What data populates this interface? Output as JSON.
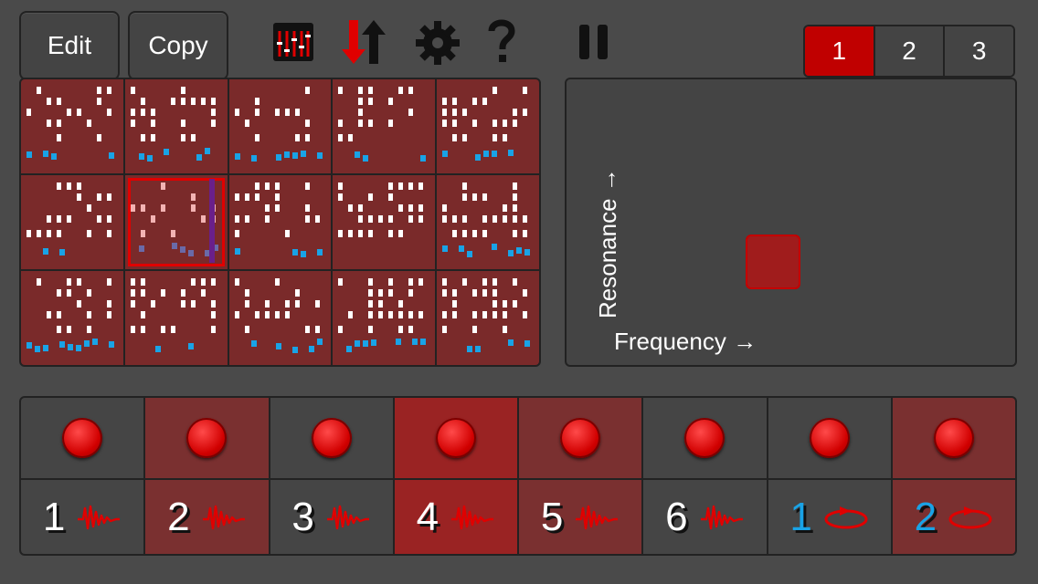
{
  "toolbar": {
    "edit_label": "Edit",
    "copy_label": "Copy",
    "icons": [
      "mixer-icon",
      "sort-arrows-icon",
      "gear-icon",
      "help-icon",
      "pause-icon"
    ]
  },
  "pages": {
    "tabs": [
      "1",
      "2",
      "3"
    ],
    "selected": "1"
  },
  "xy_pad": {
    "y_label": "Resonance →",
    "x_label": "Frequency →"
  },
  "tracks": [
    {
      "number": "1",
      "type": "synth"
    },
    {
      "number": "2",
      "type": "synth"
    },
    {
      "number": "3",
      "type": "synth"
    },
    {
      "number": "4",
      "type": "synth"
    },
    {
      "number": "5",
      "type": "synth"
    },
    {
      "number": "6",
      "type": "synth"
    },
    {
      "number": "1",
      "type": "loop"
    },
    {
      "number": "2",
      "type": "loop"
    }
  ],
  "colors": {
    "accent": "#c00000",
    "cell": "#7a2a2a",
    "blue": "#19a3e6"
  }
}
